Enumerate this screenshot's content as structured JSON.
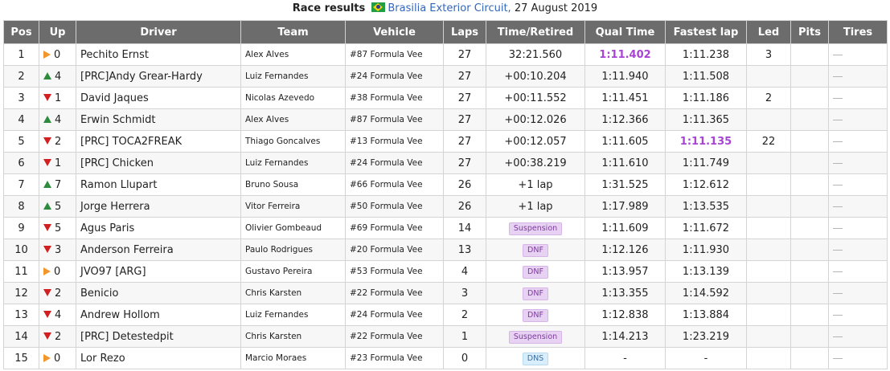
{
  "caption": {
    "label": "Race results",
    "circuit": "Brasilia Exterior Circuit,",
    "date": " 27 August 2019",
    "flag_icon": "brazil-flag-icon"
  },
  "columns": [
    "Pos",
    "Up",
    "Driver",
    "Team",
    "Vehicle",
    "Laps",
    "Time/Retired",
    "Qual Time",
    "Fastest lap",
    "Led",
    "Pits",
    "Tires"
  ],
  "rows": [
    {
      "pos": "1",
      "dir": "same",
      "up": "0",
      "driver": "Pechito Ernst",
      "team": "Alex Alves",
      "vehicle": "#87 Formula Vee",
      "laps": "27",
      "time": "32:21.560",
      "status": "",
      "qual": "1:11.402",
      "qual_best": true,
      "fast": "1:11.238",
      "fast_best": false,
      "led": "3"
    },
    {
      "pos": "2",
      "dir": "up",
      "up": "4",
      "driver": "[PRC]Andy Grear-Hardy",
      "team": "Luiz Fernandes",
      "vehicle": "#24 Formula Vee",
      "laps": "27",
      "time": "+00:10.204",
      "status": "",
      "qual": "1:11.940",
      "qual_best": false,
      "fast": "1:11.508",
      "fast_best": false,
      "led": ""
    },
    {
      "pos": "3",
      "dir": "down",
      "up": "1",
      "driver": "David Jaques",
      "team": "Nicolas Azevedo",
      "vehicle": "#38 Formula Vee",
      "laps": "27",
      "time": "+00:11.552",
      "status": "",
      "qual": "1:11.451",
      "qual_best": false,
      "fast": "1:11.186",
      "fast_best": false,
      "led": "2"
    },
    {
      "pos": "4",
      "dir": "up",
      "up": "4",
      "driver": "Erwin Schmidt",
      "team": "Alex Alves",
      "vehicle": "#87 Formula Vee",
      "laps": "27",
      "time": "+00:12.026",
      "status": "",
      "qual": "1:12.366",
      "qual_best": false,
      "fast": "1:11.365",
      "fast_best": false,
      "led": ""
    },
    {
      "pos": "5",
      "dir": "down",
      "up": "2",
      "driver": "[PRC] TOCA2FREAK",
      "team": "Thiago Goncalves",
      "vehicle": "#13 Formula Vee",
      "laps": "27",
      "time": "+00:12.057",
      "status": "",
      "qual": "1:11.605",
      "qual_best": false,
      "fast": "1:11.135",
      "fast_best": true,
      "led": "22"
    },
    {
      "pos": "6",
      "dir": "down",
      "up": "1",
      "driver": "[PRC] Chicken",
      "team": "Luiz Fernandes",
      "vehicle": "#24 Formula Vee",
      "laps": "27",
      "time": "+00:38.219",
      "status": "",
      "qual": "1:11.610",
      "qual_best": false,
      "fast": "1:11.749",
      "fast_best": false,
      "led": ""
    },
    {
      "pos": "7",
      "dir": "up",
      "up": "7",
      "driver": "Ramon Llupart",
      "team": "Bruno Sousa",
      "vehicle": "#66 Formula Vee",
      "laps": "26",
      "time": "+1 lap",
      "status": "",
      "qual": "1:31.525",
      "qual_best": false,
      "fast": "1:12.612",
      "fast_best": false,
      "led": ""
    },
    {
      "pos": "8",
      "dir": "up",
      "up": "5",
      "driver": "Jorge Herrera",
      "team": "Vitor Ferreira",
      "vehicle": "#50 Formula Vee",
      "laps": "26",
      "time": "+1 lap",
      "status": "",
      "qual": "1:17.989",
      "qual_best": false,
      "fast": "1:13.535",
      "fast_best": false,
      "led": ""
    },
    {
      "pos": "9",
      "dir": "down",
      "up": "5",
      "driver": "Agus Paris",
      "team": "Olivier Gombeaud",
      "vehicle": "#69 Formula Vee",
      "laps": "14",
      "time": "",
      "status": "Suspension",
      "qual": "1:11.609",
      "qual_best": false,
      "fast": "1:11.672",
      "fast_best": false,
      "led": ""
    },
    {
      "pos": "10",
      "dir": "down",
      "up": "3",
      "driver": "Anderson Ferreira",
      "team": "Paulo Rodrigues",
      "vehicle": "#20 Formula Vee",
      "laps": "13",
      "time": "",
      "status": "DNF",
      "qual": "1:12.126",
      "qual_best": false,
      "fast": "1:11.930",
      "fast_best": false,
      "led": ""
    },
    {
      "pos": "11",
      "dir": "same",
      "up": "0",
      "driver": "JVO97 [ARG]",
      "team": "Gustavo Pereira",
      "vehicle": "#53 Formula Vee",
      "laps": "4",
      "time": "",
      "status": "DNF",
      "qual": "1:13.957",
      "qual_best": false,
      "fast": "1:13.139",
      "fast_best": false,
      "led": ""
    },
    {
      "pos": "12",
      "dir": "down",
      "up": "2",
      "driver": "Benicio",
      "team": "Chris Karsten",
      "vehicle": "#22 Formula Vee",
      "laps": "3",
      "time": "",
      "status": "DNF",
      "qual": "1:13.355",
      "qual_best": false,
      "fast": "1:14.592",
      "fast_best": false,
      "led": ""
    },
    {
      "pos": "13",
      "dir": "down",
      "up": "4",
      "driver": "Andrew Hollom",
      "team": "Luiz Fernandes",
      "vehicle": "#24 Formula Vee",
      "laps": "2",
      "time": "",
      "status": "DNF",
      "qual": "1:12.838",
      "qual_best": false,
      "fast": "1:13.884",
      "fast_best": false,
      "led": ""
    },
    {
      "pos": "14",
      "dir": "down",
      "up": "2",
      "driver": "[PRC] Detestedpit",
      "team": "Chris Karsten",
      "vehicle": "#22 Formula Vee",
      "laps": "1",
      "time": "",
      "status": "Suspension",
      "qual": "1:14.213",
      "qual_best": false,
      "fast": "1:23.219",
      "fast_best": false,
      "led": ""
    },
    {
      "pos": "15",
      "dir": "same",
      "up": "0",
      "driver": "Lor Rezo",
      "team": "Marcio Moraes",
      "vehicle": "#23 Formula Vee",
      "laps": "0",
      "time": "",
      "status": "DNS",
      "qual": "-",
      "qual_best": false,
      "fast": "-",
      "fast_best": false,
      "led": ""
    }
  ],
  "colors": {
    "header_bg": "#6c6c6c",
    "best_time": "#a843d6",
    "gain": "#2e8b3e",
    "loss": "#d22020",
    "no_change": "#f0962b"
  }
}
